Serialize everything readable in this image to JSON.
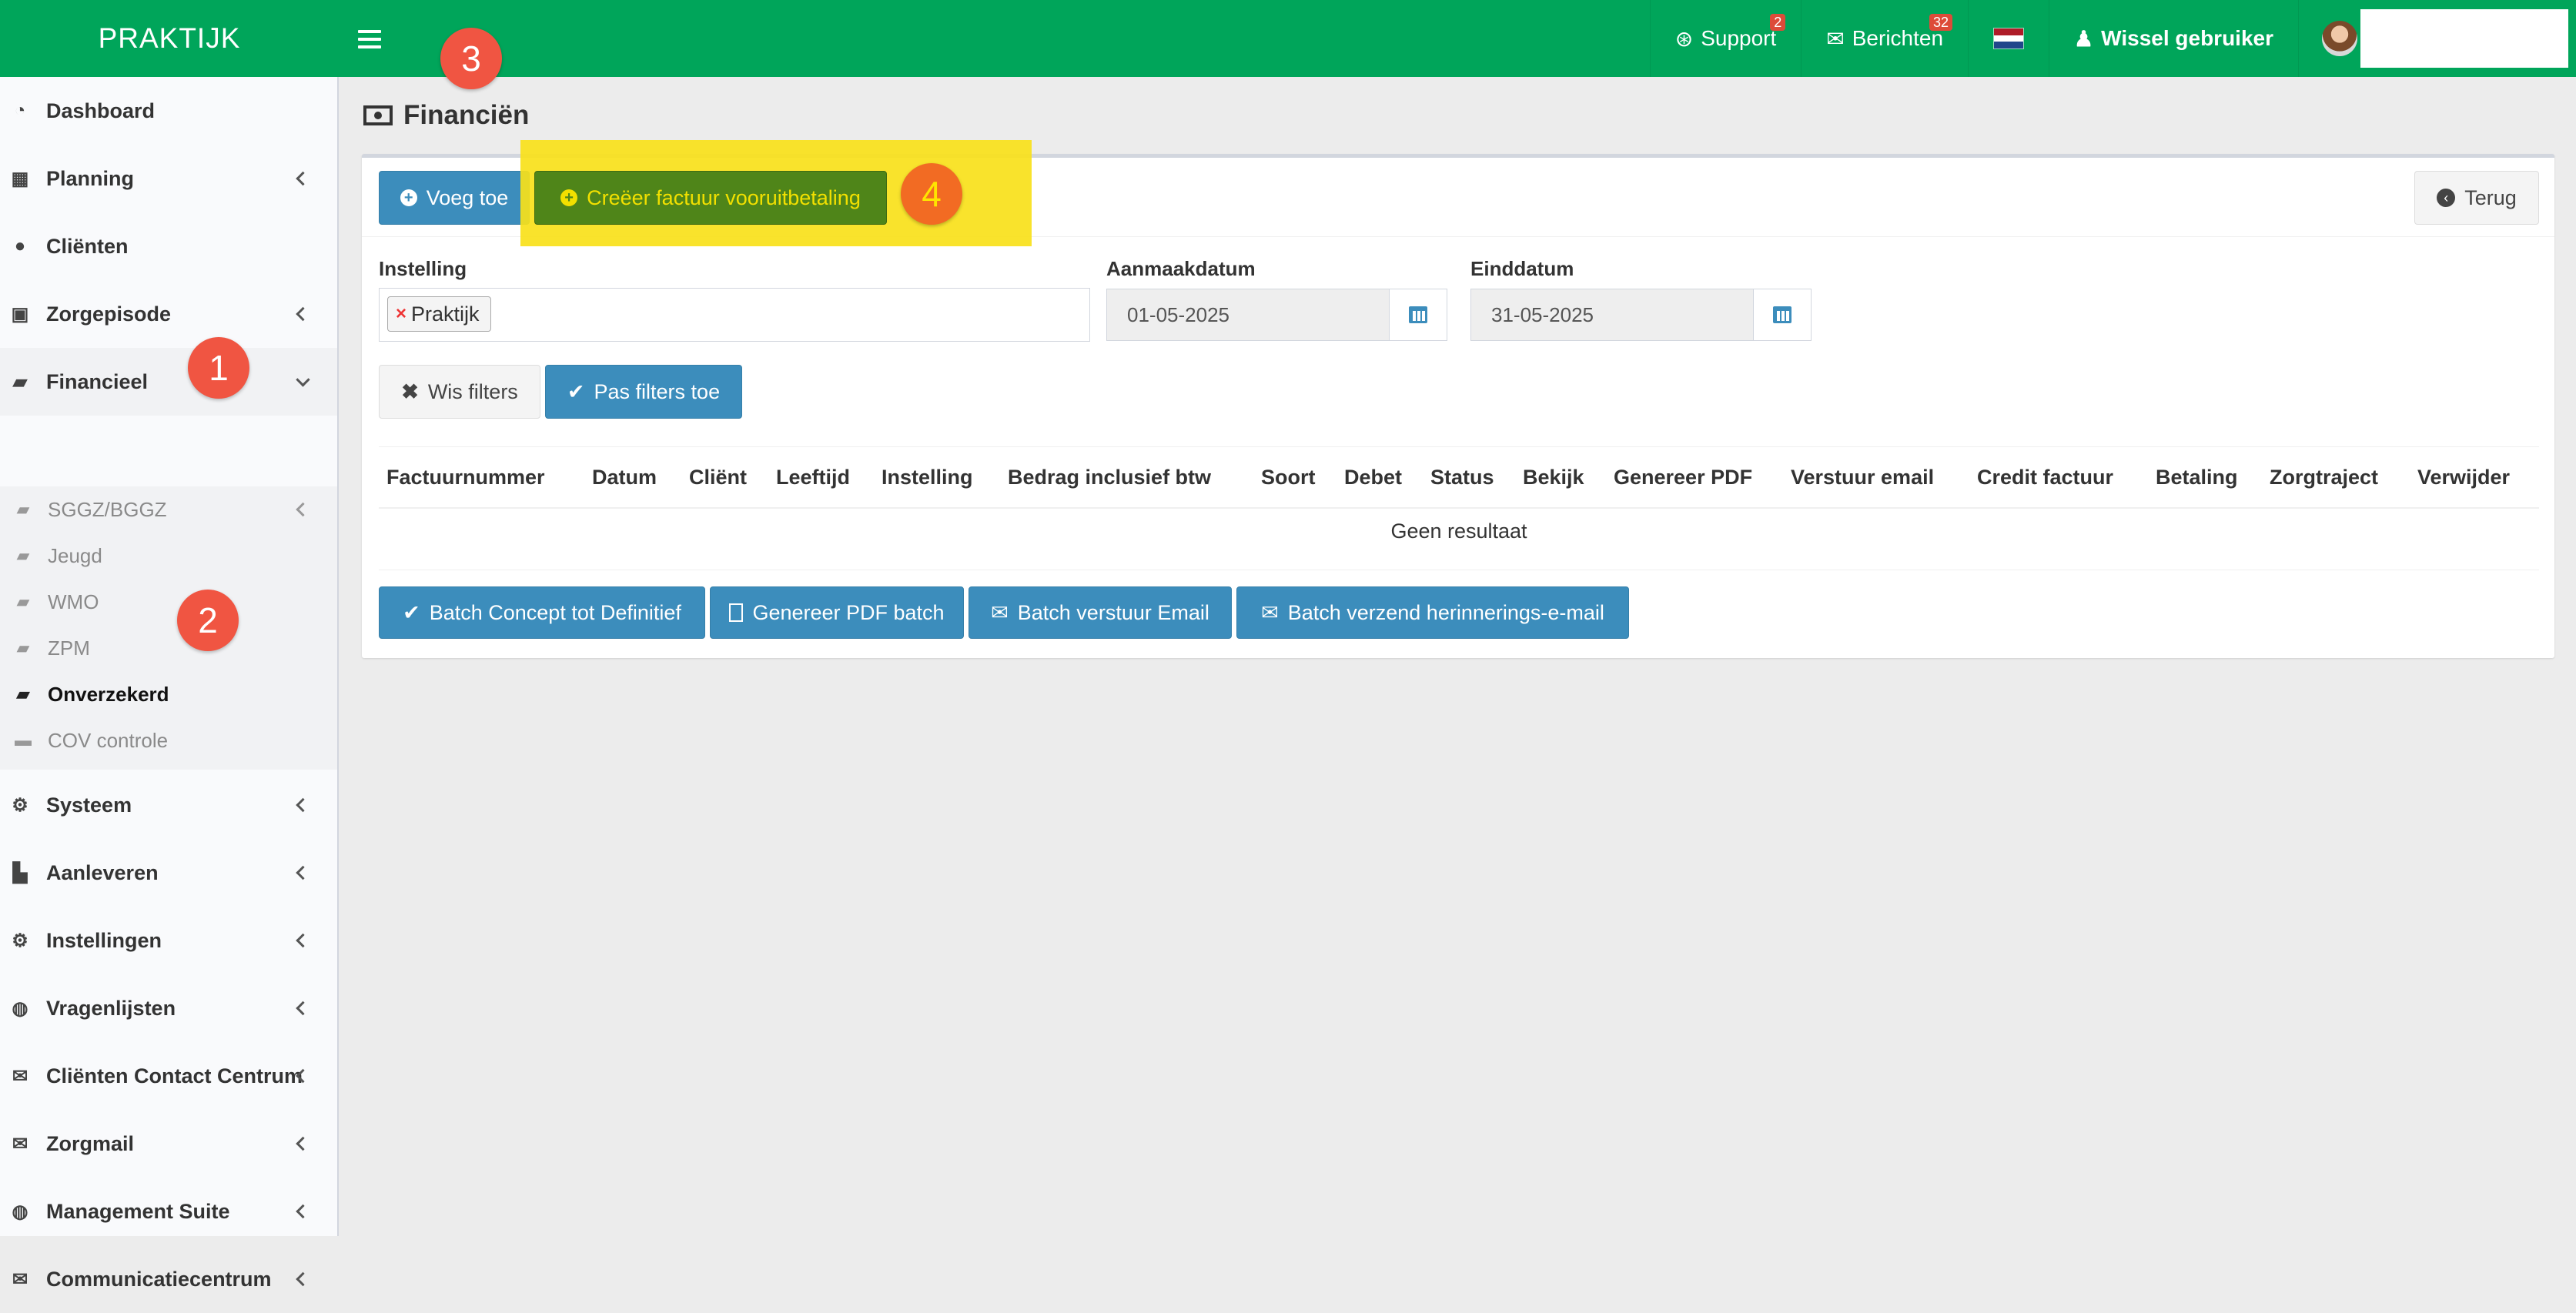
{
  "app": {
    "logo": "PRAKTIJK"
  },
  "topnav": {
    "support_label": "Support",
    "support_badge": "2",
    "messages_label": "Berichten",
    "messages_badge": "32",
    "switch_user_label": "Wissel gebruiker"
  },
  "sidebar": {
    "items": [
      {
        "label": "Dashboard"
      },
      {
        "label": "Planning"
      },
      {
        "label": "Cliënten"
      },
      {
        "label": "Zorgepisode"
      },
      {
        "label": "Financieel"
      },
      {
        "label": "Systeem"
      },
      {
        "label": "Aanleveren"
      },
      {
        "label": "Instellingen"
      },
      {
        "label": "Vragenlijsten"
      },
      {
        "label": "Cliënten Contact Centrum"
      },
      {
        "label": "Zorgmail"
      },
      {
        "label": "Management Suite"
      },
      {
        "label": "Communicatiecentrum"
      }
    ],
    "financieel_sub": [
      {
        "label": "SGGZ/BGGZ"
      },
      {
        "label": "Jeugd"
      },
      {
        "label": "WMO"
      },
      {
        "label": "ZPM"
      },
      {
        "label": "Onverzekerd"
      },
      {
        "label": "COV controle"
      }
    ]
  },
  "page": {
    "title": "Financiën"
  },
  "toolbar": {
    "add_label": "Voeg toe",
    "create_invoice_label": "Creëer factuur vooruitbetaling",
    "back_label": "Terug"
  },
  "filters": {
    "institution_label": "Instelling",
    "institution_tag": "Praktijk",
    "created_label": "Aanmaakdatum",
    "created_value": "01-05-2025",
    "end_label": "Einddatum",
    "end_value": "31-05-2025",
    "clear_label": "Wis filters",
    "apply_label": "Pas filters toe"
  },
  "table": {
    "columns": [
      "Factuurnummer",
      "Datum",
      "Cliënt",
      "Leeftijd",
      "Instelling",
      "Bedrag inclusief btw",
      "Soort",
      "Debet",
      "Status",
      "Bekijk",
      "Genereer PDF",
      "Verstuur email",
      "Credit factuur",
      "Betaling",
      "Zorgtraject",
      "Verwijder"
    ],
    "empty_message": "Geen resultaat"
  },
  "batch": {
    "concept_label": "Batch Concept tot Definitief",
    "pdf_label": "Genereer PDF batch",
    "email_label": "Batch verstuur Email",
    "reminder_label": "Batch verzend herinnerings-e-mail"
  },
  "annotations": [
    "1",
    "2",
    "3",
    "4"
  ],
  "colors": {
    "topbar": "#00a55a",
    "primary": "#3c8dbc",
    "highlight": "#f8e11a",
    "annotation": "#f05542"
  }
}
